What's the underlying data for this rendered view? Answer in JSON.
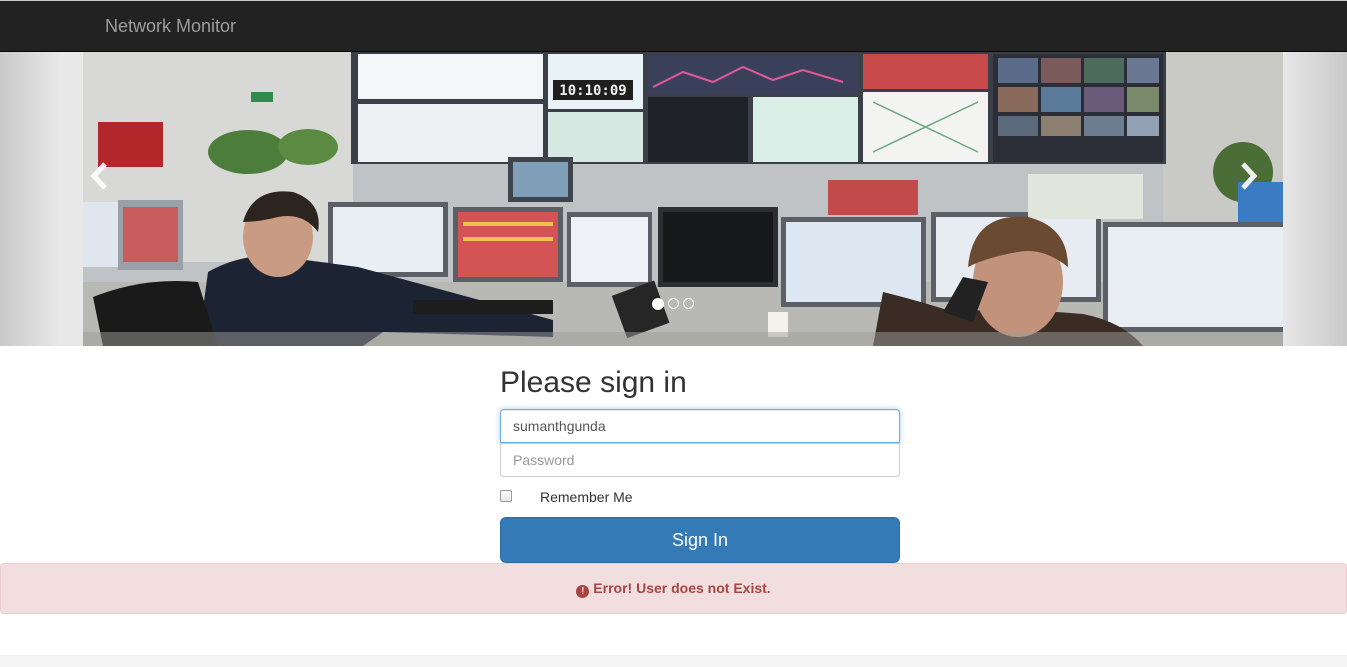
{
  "navbar": {
    "brand": "Network Monitor"
  },
  "carousel": {
    "clock_text": "10:10:09",
    "prev_icon": "chevron-left-icon",
    "next_icon": "chevron-right-icon",
    "slide_count": 3,
    "active_slide": 1
  },
  "signin": {
    "heading": "Please sign in",
    "username_value": "sumanthgunda",
    "password_placeholder": "Password",
    "remember_label": "Remember Me",
    "submit_label": "Sign In"
  },
  "alert": {
    "icon": "exclamation-circle-icon",
    "message": "Error! User does not Exist."
  },
  "colors": {
    "navbar_bg": "#222222",
    "brand_text": "#9d9d9d",
    "primary": "#337ab7",
    "alert_bg": "#f2dede",
    "alert_text": "#a94442"
  }
}
